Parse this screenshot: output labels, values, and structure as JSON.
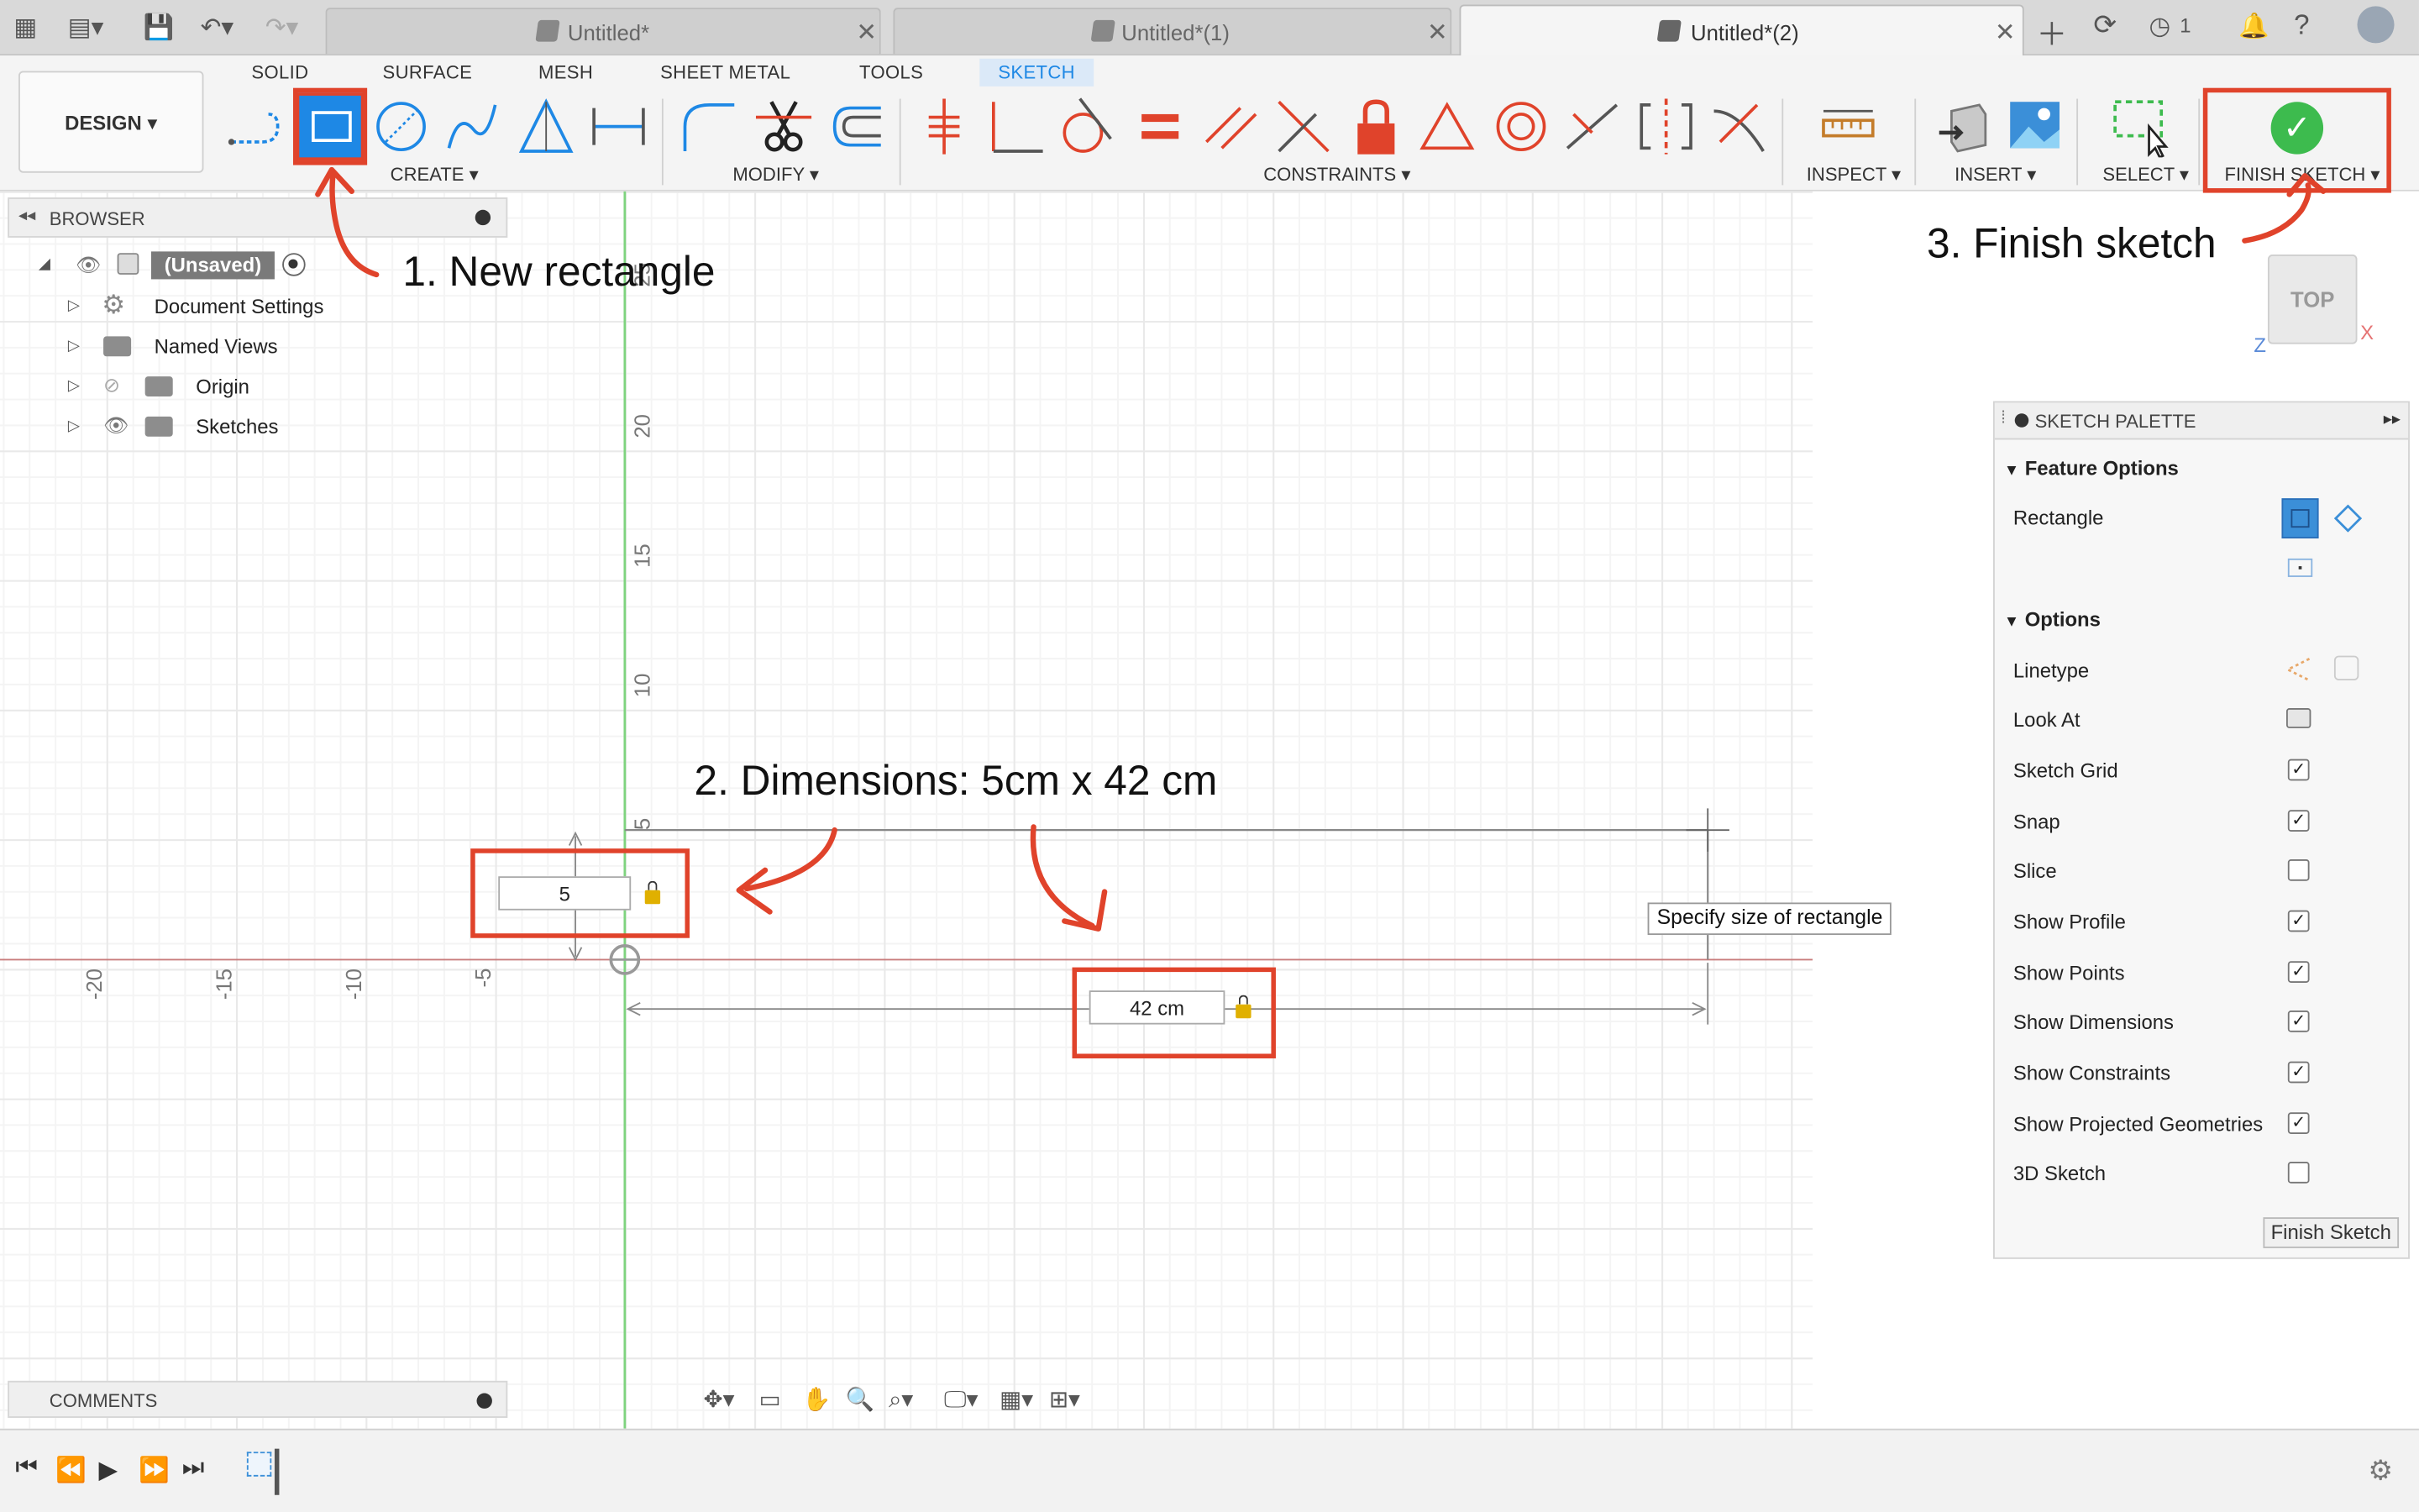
{
  "tabs": [
    {
      "label": "Untitled*",
      "active": false
    },
    {
      "label": "Untitled*(1)",
      "active": false
    },
    {
      "label": "Untitled*(2)",
      "active": true
    }
  ],
  "topbar": {
    "job_count": "1"
  },
  "workspace": {
    "design_label": "DESIGN ▾"
  },
  "ribbon_tabs": [
    "SOLID",
    "SURFACE",
    "MESH",
    "SHEET METAL",
    "TOOLS",
    "SKETCH"
  ],
  "groups": {
    "create": "CREATE ▾",
    "modify": "MODIFY ▾",
    "constraints": "CONSTRAINTS ▾",
    "inspect": "INSPECT ▾",
    "insert": "INSERT ▾",
    "select": "SELECT ▾",
    "finish": "FINISH SKETCH ▾"
  },
  "browser": {
    "title": "BROWSER",
    "root": "(Unsaved)",
    "items": [
      "Document Settings",
      "Named Views",
      "Origin",
      "Sketches"
    ]
  },
  "comments": {
    "title": "COMMENTS"
  },
  "palette": {
    "title": "SKETCH PALETTE",
    "feature_options": "Feature Options",
    "rectangle_label": "Rectangle",
    "options": "Options",
    "rows": [
      {
        "label": "Linetype",
        "kind": "icons"
      },
      {
        "label": "Look At",
        "kind": "icon"
      },
      {
        "label": "Sketch Grid",
        "checked": true
      },
      {
        "label": "Snap",
        "checked": true
      },
      {
        "label": "Slice",
        "checked": false
      },
      {
        "label": "Show Profile",
        "checked": true
      },
      {
        "label": "Show Points",
        "checked": true
      },
      {
        "label": "Show Dimensions",
        "checked": true
      },
      {
        "label": "Show Constraints",
        "checked": true
      },
      {
        "label": "Show Projected Geometries",
        "checked": true
      },
      {
        "label": "3D Sketch",
        "checked": false
      }
    ],
    "finish_button": "Finish Sketch"
  },
  "canvas": {
    "y_ticks": [
      "25",
      "20",
      "15",
      "10",
      "5"
    ],
    "x_ticks": [
      "-20",
      "-15",
      "-10",
      "-5"
    ],
    "height_value": "5",
    "width_value": "42 cm",
    "tooltip": "Specify size of rectangle",
    "viewcube": "TOP",
    "axis_x": "X",
    "axis_z": "Z"
  },
  "annotations": {
    "step1": "1. New rectangle",
    "step2": "2. Dimensions: 5cm x 42 cm",
    "step3": "3. Finish sketch"
  },
  "colors": {
    "accent": "#1e88e5",
    "annotation_red": "#e0432b",
    "finish_green": "#3dbb4e",
    "axis_green": "#7ed37e",
    "axis_red": "#c97c7c"
  }
}
